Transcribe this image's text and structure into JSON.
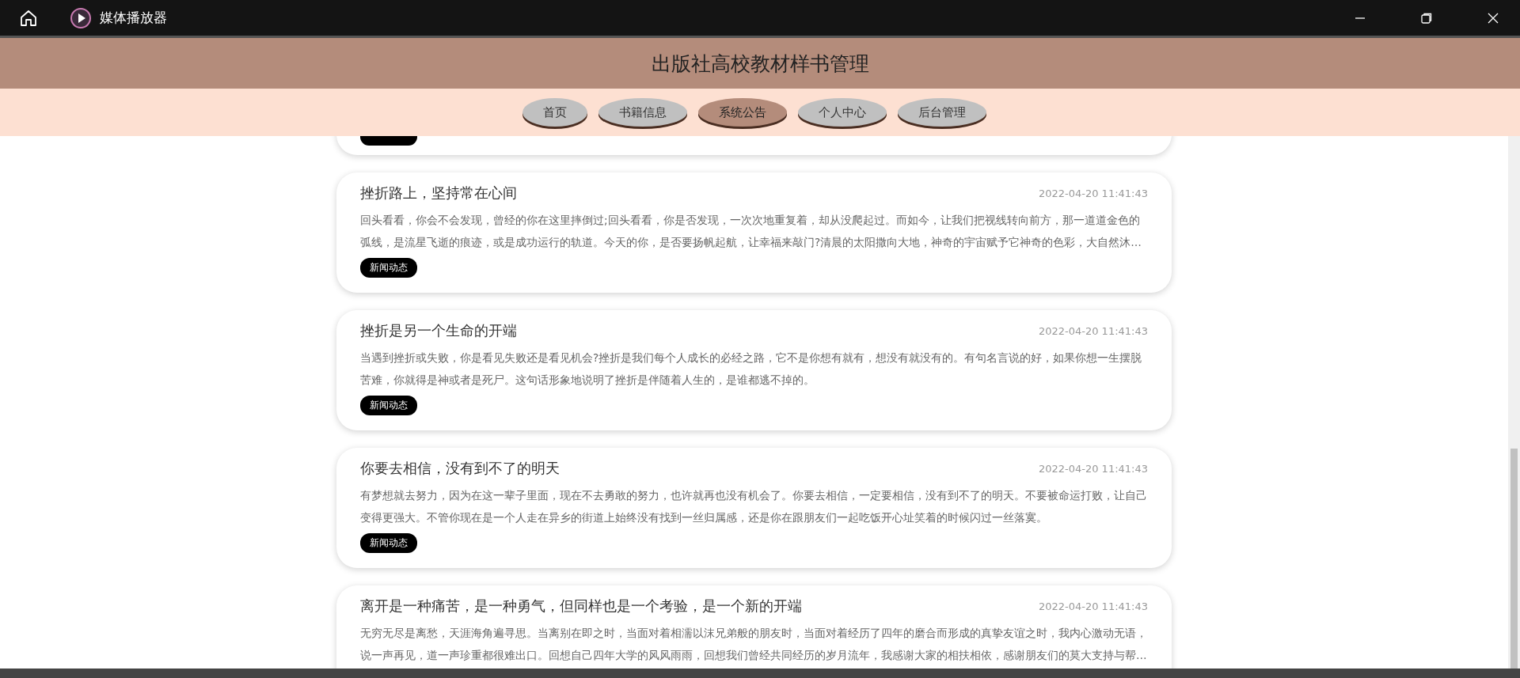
{
  "window": {
    "title": "媒体播放器"
  },
  "header": {
    "title": "出版社高校教材样书管理"
  },
  "nav": [
    {
      "label": "首页",
      "selected": false
    },
    {
      "label": "书籍信息",
      "selected": false
    },
    {
      "label": "系统公告",
      "selected": true
    },
    {
      "label": "个人中心",
      "selected": false
    },
    {
      "label": "后台管理",
      "selected": false
    }
  ],
  "posts": [
    {
      "title": "挫折路上，坚持常在心间",
      "date": "2022-04-20 11:41:43",
      "body": "回头看看，你会不会发现，曾经的你在这里摔倒过;回头看看，你是否发现，一次次地重复着，却从没爬起过。而如今，让我们把视线转向前方，那一道道金色的弧线，是流星飞逝的痕迹，或是成功运行的轨道。今天的你，是否要扬帆起航，让幸福来敲门?清晨的太阳撒向大地，神奇的宇宙赋予它神奇的色彩，大自然沐…",
      "tag": "新闻动态"
    },
    {
      "title": "挫折是另一个生命的开端",
      "date": "2022-04-20 11:41:43",
      "body": "当遇到挫折或失败，你是看见失败还是看见机会?挫折是我们每个人成长的必经之路，它不是你想有就有，想没有就没有的。有句名言说的好，如果你想一生摆脱苦难，你就得是神或者是死尸。这句话形象地说明了挫折是伴随着人生的，是谁都逃不掉的。",
      "tag": "新闻动态"
    },
    {
      "title": "你要去相信，没有到不了的明天",
      "date": "2022-04-20 11:41:43",
      "body": "有梦想就去努力，因为在这一辈子里面，现在不去勇敢的努力，也许就再也没有机会了。你要去相信，一定要相信，没有到不了的明天。不要被命运打败，让自己变得更强大。不管你现在是一个人走在异乡的街道上始终没有找到一丝归属感，还是你在跟朋友们一起吃饭开心址笑着的时候闪过一丝落寞。",
      "tag": "新闻动态"
    },
    {
      "title": "离开是一种痛苦，是一种勇气，但同样也是一个考验，是一个新的开端",
      "date": "2022-04-20 11:41:43",
      "body": "无穷无尽是离愁，天涯海角遍寻思。当离别在即之时，当面对着相濡以沫兄弟般的朋友时，当面对着经历了四年的磨合而形成的真挚友谊之时，我内心激动无语，说一声再见，道一声珍重都很难出口。回想自己四年大学的风风雨雨，回想我们曾经共同经历的岁月流年，我感谢大家的相扶相依，感谢朋友们的莫大支持与帮…"
    }
  ]
}
